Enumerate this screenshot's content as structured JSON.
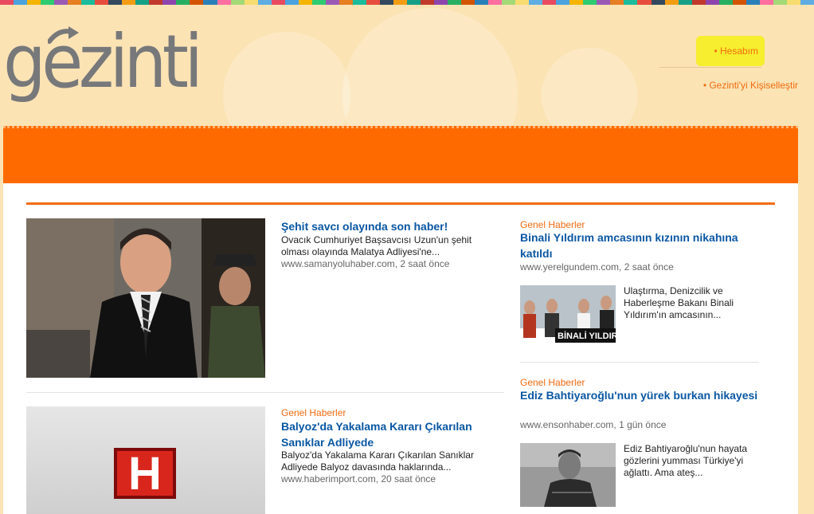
{
  "header": {
    "logo_text": "gezinti",
    "account_link": "• Hesabım",
    "personalize_link": "• Gezinti'yi Kişiselleştir",
    "stripe_colors": [
      "#e84a5f",
      "#4aa3df",
      "#f4b400",
      "#2ecc71",
      "#9b59b6",
      "#e67e22",
      "#1abc9c",
      "#e74c3c",
      "#34495e",
      "#f39c12",
      "#16a085",
      "#c0392b",
      "#8e44ad",
      "#27ae60",
      "#d35400",
      "#2980b9",
      "#ff6fa0",
      "#a3d977",
      "#f7dc6f",
      "#5dade2"
    ]
  },
  "stories": {
    "lead": {
      "title": "Şehit savcı olayında son haber!",
      "snippet": "Ovacık Cumhuriyet Başsavcısı Uzun'un şehit olması olayında Malatya Adliyesi'ne...",
      "source": "www.samanyoluhaber.com, 2 saat önce"
    },
    "second": {
      "category": "Genel Haberler",
      "title": "Balyoz'da Yakalama Kararı Çıkarılan Sanıklar Adliyede",
      "snippet": "Balyoz'da Yakalama Kararı Çıkarılan Sanıklar Adliyede Balyoz davasında haklarında...",
      "source": "www.haberimport.com, 20 saat önce",
      "logo_letter": "H"
    },
    "right1": {
      "category": "Genel Haberler",
      "title": "Binali Yıldırım amcasının kızının nikahına katıldı",
      "source": "www.yerelgundem.com, 2 saat önce",
      "snippet": "Ulaştırma, Denizcilik ve Haberleşme Bakanı Binali Yıldırım'ın amcasının...",
      "image_caption": "BİNALİ YILDIRIM"
    },
    "right2": {
      "category": "Genel Haberler",
      "title": "Ediz Bahtiyaroğlu'nun yürek burkan hikayesi",
      "source": "www.ensonhaber.com, 1 gün önce",
      "snippet": "Ediz Bahtiyaroğlu'nun hayata gözlerini yumması Türkiye'yi ağlattı. Ama ateş..."
    }
  }
}
